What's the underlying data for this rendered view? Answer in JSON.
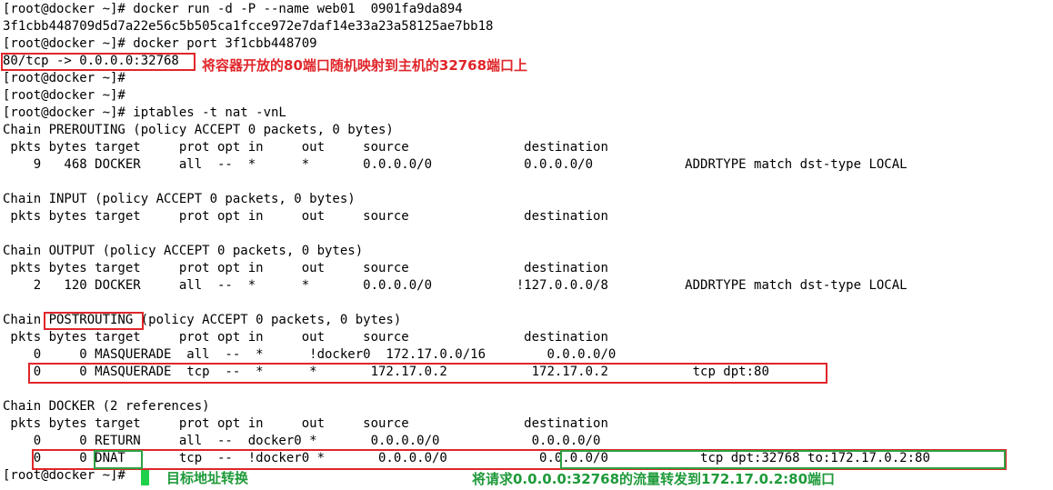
{
  "terminal": {
    "lines": [
      "[root@docker ~]# docker run -d -P --name web01  0901fa9da894",
      "3f1cbb448709d5d7a22e56c5b505ca1fcce972e7daf14e33a23a58125ae7bb18",
      "[root@docker ~]# docker port 3f1cbb448709",
      "80/tcp -> 0.0.0.0:32768",
      "[root@docker ~]#",
      "[root@docker ~]#",
      "[root@docker ~]# iptables -t nat -vnL",
      "Chain PREROUTING (policy ACCEPT 0 packets, 0 bytes)",
      " pkts bytes target     prot opt in     out     source               destination",
      "    9   468 DOCKER     all  --  *      *       0.0.0.0/0            0.0.0.0/0            ADDRTYPE match dst-type LOCAL",
      "",
      "Chain INPUT (policy ACCEPT 0 packets, 0 bytes)",
      " pkts bytes target     prot opt in     out     source               destination",
      "",
      "Chain OUTPUT (policy ACCEPT 0 packets, 0 bytes)",
      " pkts bytes target     prot opt in     out     source               destination",
      "    2   120 DOCKER     all  --  *      *       0.0.0.0/0           !127.0.0.0/8          ADDRTYPE match dst-type LOCAL",
      "",
      "Chain POSTROUTING (policy ACCEPT 0 packets, 0 bytes)",
      " pkts bytes target     prot opt in     out     source               destination",
      "    0     0 MASQUERADE  all  --  *      !docker0  172.17.0.0/16        0.0.0.0/0",
      "    0     0 MASQUERADE  tcp  --  *      *       172.17.0.2           172.17.0.2           tcp dpt:80",
      "",
      "Chain DOCKER (2 references)",
      " pkts bytes target     prot opt in     out     source               destination",
      "    0     0 RETURN     all  --  docker0 *       0.0.0.0/0            0.0.0.0/0",
      "    0     0 DNAT       tcp  --  !docker0 *       0.0.0.0/0            0.0.0.0/0            tcp dpt:32768 to:172.17.0.2:80",
      "[root@docker ~]#"
    ]
  },
  "annotations": {
    "port_mapping": "将容器开放的80端口随机映射到主机的32768端口上",
    "dnat": "目标地址转换",
    "traffic": "将请求0.0.0.0:32768的流量转发到172.17.0.2:80端口"
  },
  "colors": {
    "annotation_red": "#e0262a",
    "annotation_green": "#1f9a3a",
    "cursor": "#1fd14a"
  }
}
